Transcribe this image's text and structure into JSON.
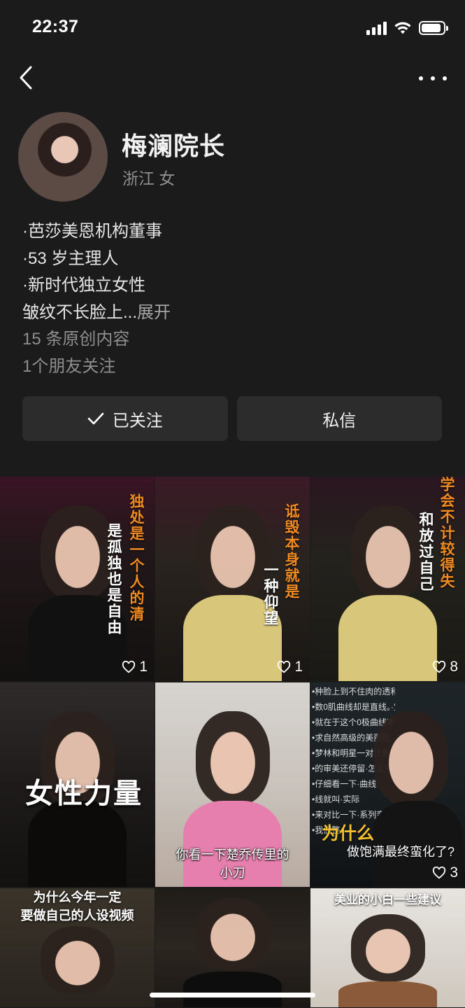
{
  "status_bar": {
    "time": "22:37",
    "battery_level": 0.9
  },
  "profile": {
    "name": "梅澜院长",
    "location_gender": "浙江 女",
    "bio_lines": [
      "·芭莎美恩机构董事",
      "·53 岁主理人",
      "·新时代独立女性"
    ],
    "bio_truncated": "皱纹不长脸上...",
    "expand_label": "展开",
    "original_count": "15 条原创内容",
    "friends_following": "1个朋友关注"
  },
  "actions": {
    "followed_label": "已关注",
    "message_label": "私信"
  },
  "videos": [
    {
      "likes": "1",
      "caption_lines": [
        "独处是一个人的清",
        "是孤独也是自由"
      ]
    },
    {
      "likes": "1",
      "caption_lines": [
        "诋毁本身就是",
        "一种仰望"
      ]
    },
    {
      "likes": "8",
      "caption_lines": [
        "学会不计较得失",
        "和放过自己"
      ]
    },
    {
      "likes": "",
      "caption": "女性力量"
    },
    {
      "likes": "",
      "caption": "你看一下楚乔传里的",
      "caption2": "小刀"
    },
    {
      "likes": "3",
      "caption": "为什么",
      "caption2": "做饱满最终蛮化了?"
    },
    {
      "likes": "",
      "caption": "为什么今年一定",
      "caption2": "要做自己的人设视频"
    },
    {
      "likes": "",
      "caption": ""
    },
    {
      "likes": "",
      "caption": "美业的小白一些建议"
    }
  ],
  "board_text": [
    "•种脸上到不住肉的透和感?•除了先天性的",
    "•数0肌曲线却是直线。·宝宝拿着一条",
    "•就在于这个0极曲线率·相通的,在",
    "•求自然高级的美丽丽,·求不迷路。",
    "•梦林和明星一对比影·高级?阿红",
    "•的审美还停留·怎么今天",
    "•仔细看一下·曲线",
    "•线就叫·实际",
    "•来对比一下·系列变",
    "•我们整·"
  ]
}
